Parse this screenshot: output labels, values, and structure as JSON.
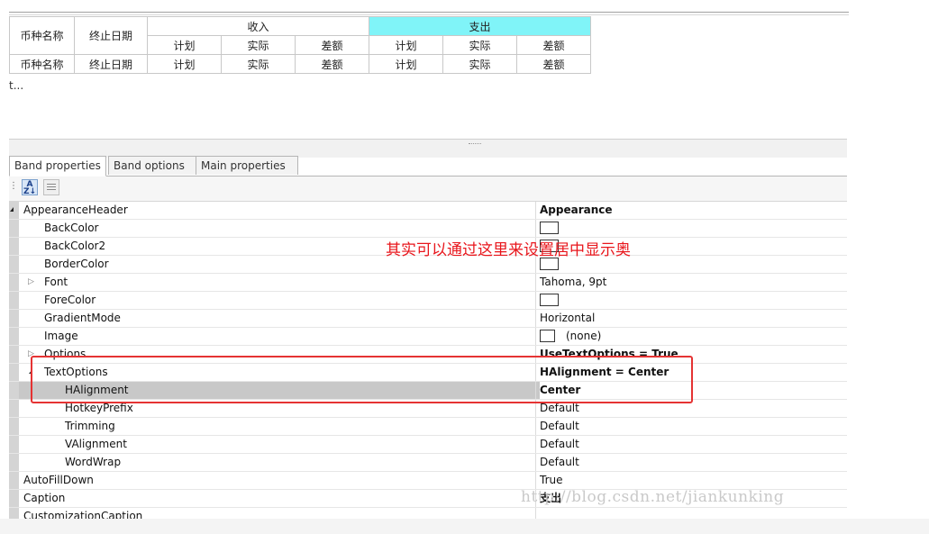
{
  "band_grid": {
    "top_row": {
      "currency_name": "币种名称",
      "end_date": "终止日期",
      "income_band": "收入",
      "expense_band": "支出",
      "sub_columns": [
        "计划",
        "实际",
        "差额",
        "计划",
        "实际",
        "差额"
      ]
    },
    "data_row": [
      "币种名称",
      "终止日期",
      "计划",
      "实际",
      "差额",
      "计划",
      "实际",
      "差额"
    ],
    "truncated_text": "t..."
  },
  "tabs": [
    {
      "label": "Band properties",
      "active": true
    },
    {
      "label": "Band options",
      "active": false
    },
    {
      "label": "Main properties",
      "active": false
    }
  ],
  "toolbar": {
    "alphabetical_icon": "sort-az-icon",
    "categorized_icon": "categorized-icon",
    "description_icon": "description-icon"
  },
  "properties": [
    {
      "name": "AppearanceHeader",
      "value": "Appearance",
      "value_bold": true,
      "expanded": true
    },
    {
      "name": "BackColor",
      "value": "",
      "swatch": true
    },
    {
      "name": "BackColor2",
      "value": "",
      "swatch": true
    },
    {
      "name": "BorderColor",
      "value": "",
      "swatch": true
    },
    {
      "name": "Font",
      "value": "Tahoma, 9pt",
      "expandable": true
    },
    {
      "name": "ForeColor",
      "value": "",
      "swatch": true
    },
    {
      "name": "GradientMode",
      "value": "Horizontal"
    },
    {
      "name": "Image",
      "value": "(none)",
      "image_box": true
    },
    {
      "name": "Options",
      "value": "UseTextOptions = True",
      "value_bold": true,
      "expandable": true
    },
    {
      "name": "TextOptions",
      "value": "HAlignment = Center",
      "value_bold": true,
      "expanded": true
    },
    {
      "name": "HAlignment",
      "value": "Center",
      "value_bold": true,
      "selected": true
    },
    {
      "name": "HotkeyPrefix",
      "value": "Default"
    },
    {
      "name": "Trimming",
      "value": "Default"
    },
    {
      "name": "VAlignment",
      "value": "Default"
    },
    {
      "name": "WordWrap",
      "value": "Default"
    },
    {
      "name": "AutoFillDown",
      "value": "True"
    },
    {
      "name": "Caption",
      "value": "支出",
      "value_bold": true
    },
    {
      "name": "CustomizationCaption",
      "value": ""
    }
  ],
  "annotation": {
    "note": "其实可以通过这里来设置居中显示奥",
    "watermark": "http://blog.csdn.net/jiankunking",
    "note_color": "#e8151b"
  },
  "colors": {
    "expense_band_bg": "#80f4f8",
    "selected_row": "#c8c8c8",
    "highlight_box": "#e53333"
  }
}
